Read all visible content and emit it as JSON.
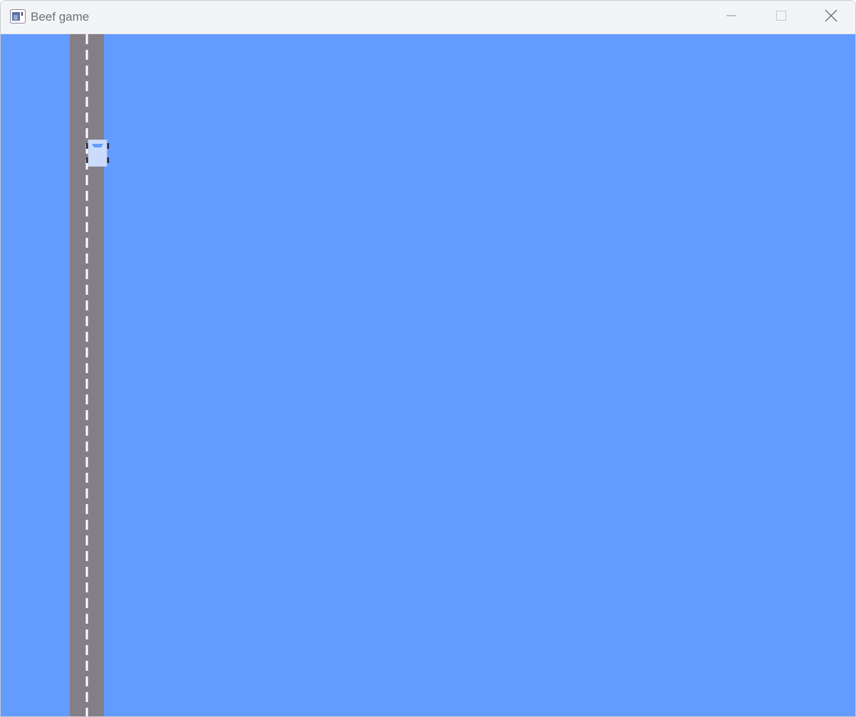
{
  "window": {
    "title": "Beef game",
    "app_icon": "app-icon",
    "buttons": {
      "minimize_icon": "minimize-icon",
      "maximize_icon": "maximize-icon",
      "close_icon": "close-icon"
    }
  },
  "game": {
    "background_color": "#639bff",
    "road_color": "#847e87",
    "lane_marking_color": "#ffffff",
    "car": {
      "body_color": "#cbdbfc",
      "window_color": "#639bff",
      "wheel_color": "#222034"
    }
  }
}
